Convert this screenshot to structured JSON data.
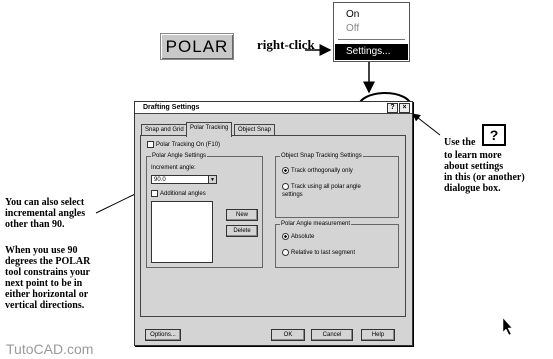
{
  "polar_button": {
    "label": "POLAR"
  },
  "right_click_label": "right-click",
  "context_menu": {
    "items": [
      "On",
      "Off"
    ],
    "selected": "Settings..."
  },
  "dialog": {
    "title": "Drafting Settings",
    "help_button": "?",
    "close_button": "×",
    "tabs": [
      "Snap and Grid",
      "Polar Tracking",
      "Object Snap"
    ],
    "polar_tracking_on": "Polar Tracking On (F10)",
    "polar_angle_settings": {
      "title": "Polar Angle Settings",
      "increment_label": "Increment angle:",
      "increment_value": "90.0",
      "additional_angles": "Additional angles",
      "new_button": "New",
      "delete_button": "Delete"
    },
    "object_snap_tracking": {
      "title": "Object Snap Tracking Settings",
      "option1": "Track orthogonally only",
      "option2": "Track using all polar angle settings"
    },
    "polar_measurement": {
      "title": "Polar Angle measurement",
      "option1": "Absolute",
      "option2": "Relative to last segment"
    },
    "options_button": "Options...",
    "ok_button": "OK",
    "cancel_button": "Cancel",
    "help_label": "Help"
  },
  "left_note_1": [
    "You can also select",
    "incremental angles",
    "other than 90."
  ],
  "left_note_2": [
    "When you use 90",
    "degrees the POLAR",
    "tool constrains your",
    "next point to be in",
    "either horizontal or",
    "vertical directions."
  ],
  "right_note": {
    "use_the": "Use the",
    "icon": "?",
    "lines": [
      "to learn more",
      "about settings",
      "in this (or another)",
      "dialogue box."
    ]
  },
  "watermark": "TutoCAD.com"
}
